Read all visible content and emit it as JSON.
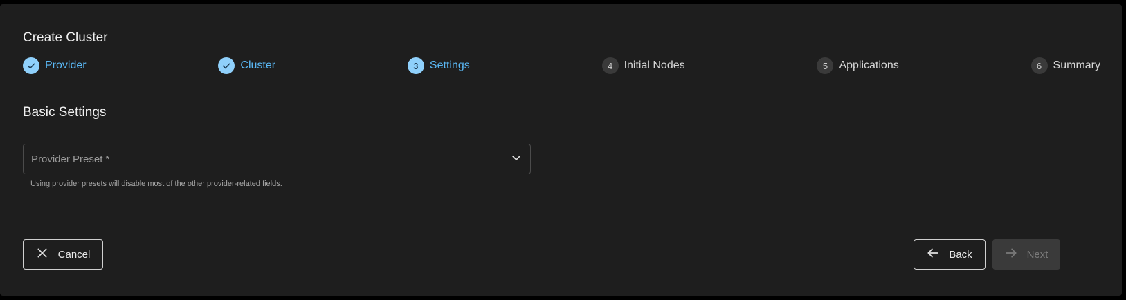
{
  "title": "Create Cluster",
  "stepper": {
    "steps": [
      {
        "number": "1",
        "label": "Provider",
        "state": "completed"
      },
      {
        "number": "2",
        "label": "Cluster",
        "state": "completed"
      },
      {
        "number": "3",
        "label": "Settings",
        "state": "active"
      },
      {
        "number": "4",
        "label": "Initial Nodes",
        "state": "pending"
      },
      {
        "number": "5",
        "label": "Applications",
        "state": "pending"
      },
      {
        "number": "6",
        "label": "Summary",
        "state": "pending"
      }
    ]
  },
  "basic_settings": {
    "title": "Basic Settings",
    "provider_preset": {
      "placeholder": "Provider Preset *",
      "value": "",
      "hint": "Using provider presets will disable most of the other provider-related fields."
    }
  },
  "footer": {
    "cancel_label": "Cancel",
    "back_label": "Back",
    "next_label": "Next"
  },
  "colors": {
    "accent": "#5ab8f5",
    "background": "#1e1e1e",
    "disabled": "#3a3a3a"
  },
  "icons": {
    "check": "check-icon",
    "chevron": "chevron-down-icon",
    "close": "close-icon",
    "back": "arrow-left-icon",
    "next": "arrow-right-icon"
  }
}
